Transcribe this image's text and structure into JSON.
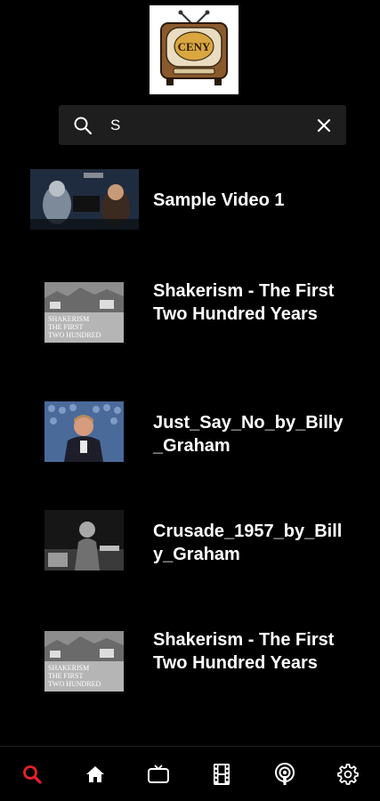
{
  "app": {
    "logo_alt": "TV logo"
  },
  "search": {
    "value": "S",
    "placeholder": ""
  },
  "results": [
    {
      "title": "Sample Video 1"
    },
    {
      "title": "Shakerism - The First Two Hundred Years",
      "thumb_text": "SHAKERISM THE FIRST TWO HUNDRED YEARS"
    },
    {
      "title": "Just_Say_No_by_Billy_Graham"
    },
    {
      "title": "Crusade_1957_by_Billy_Graham"
    },
    {
      "title": "Shakerism - The First Two Hundred Years",
      "thumb_text": "SHAKERISM THE FIRST TWO HUNDRED YEARS"
    }
  ],
  "nav": {
    "items": [
      {
        "icon": "search-icon",
        "active": true
      },
      {
        "icon": "home-icon",
        "active": false
      },
      {
        "icon": "tv-icon",
        "active": false
      },
      {
        "icon": "film-icon",
        "active": false
      },
      {
        "icon": "podcast-icon",
        "active": false
      },
      {
        "icon": "gear-icon",
        "active": false
      }
    ]
  },
  "colors": {
    "accent": "#e8202a",
    "background": "#000000",
    "search_bg": "#1e1e1e",
    "text": "#ffffff"
  }
}
